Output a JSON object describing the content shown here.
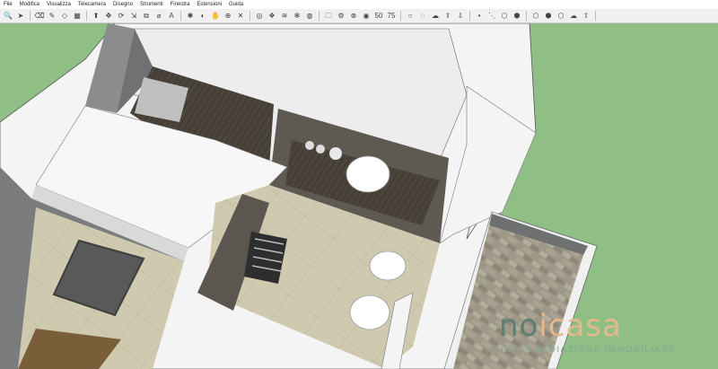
{
  "menu": {
    "items": [
      "File",
      "Modifica",
      "Visualizza",
      "Telecamera",
      "Disegno",
      "Strumenti",
      "Finestra",
      "Estensioni",
      "Guida"
    ]
  },
  "toolbar": {
    "tools": [
      {
        "name": "search-icon",
        "glyph": "🔍"
      },
      {
        "name": "select-arrow-icon",
        "glyph": "➤"
      },
      {
        "name": "eraser-icon",
        "glyph": "⌫"
      },
      {
        "name": "pencil-icon",
        "glyph": "✎"
      },
      {
        "name": "shape-icon",
        "glyph": "◇"
      },
      {
        "name": "paint-bucket-icon",
        "glyph": "▦"
      },
      {
        "name": "push-pull-icon",
        "glyph": "⬆"
      },
      {
        "name": "move-icon",
        "glyph": "✥"
      },
      {
        "name": "rotate-icon",
        "glyph": "⟳"
      },
      {
        "name": "scale-icon",
        "glyph": "⇲"
      },
      {
        "name": "offset-icon",
        "glyph": "⧉"
      },
      {
        "name": "tape-measure-icon",
        "glyph": "⌀"
      },
      {
        "name": "text-icon",
        "glyph": "A"
      },
      {
        "name": "axes-icon",
        "glyph": "✱"
      },
      {
        "name": "orbit-icon",
        "glyph": "◐"
      },
      {
        "name": "pan-icon",
        "glyph": "✋"
      },
      {
        "name": "zoom-icon",
        "glyph": "⊕"
      },
      {
        "name": "zoom-extents-icon",
        "glyph": "✕"
      },
      {
        "name": "warehouse-icon",
        "glyph": "◎"
      },
      {
        "name": "extension-icon",
        "glyph": "❖"
      },
      {
        "name": "layers-icon",
        "glyph": "≋"
      },
      {
        "name": "style-icon",
        "glyph": "✻"
      },
      {
        "name": "components-icon",
        "glyph": "◍"
      },
      {
        "name": "folder-icon",
        "glyph": "🗀"
      },
      {
        "name": "gear-icon",
        "glyph": "⚙"
      },
      {
        "name": "close-icon",
        "glyph": "⊗"
      },
      {
        "name": "profile-icon",
        "glyph": "◉"
      },
      {
        "name": "fifty-icon",
        "glyph": "50"
      },
      {
        "name": "seventy-five-icon",
        "glyph": "75"
      },
      {
        "name": "circle-outline-icon",
        "glyph": "○"
      },
      {
        "name": "ring-icon",
        "glyph": "◌"
      },
      {
        "name": "cloud-icon",
        "glyph": "☁"
      },
      {
        "name": "cloud-upload-icon",
        "glyph": "⇪"
      },
      {
        "name": "cloud-download-icon",
        "glyph": "⇩"
      },
      {
        "name": "dot-icon",
        "glyph": "•"
      },
      {
        "name": "line-icon",
        "glyph": "⋱"
      },
      {
        "name": "hexagon-icon",
        "glyph": "⬡"
      },
      {
        "name": "hexagon-gear-icon",
        "glyph": "⬢"
      },
      {
        "name": "hexagon-outline-icon",
        "glyph": "⬡"
      },
      {
        "name": "cube-icon",
        "glyph": "⬢"
      },
      {
        "name": "hexagon-dots-icon",
        "glyph": "⬡"
      },
      {
        "name": "cloud-sync-icon",
        "glyph": "☁"
      },
      {
        "name": "cloud-arrow-icon",
        "glyph": "⇧"
      }
    ]
  },
  "watermark": {
    "logo_part1": "no",
    "logo_part2": "icasa",
    "tagline": "INTERMEDIAZIONE IMMOBILIARE"
  },
  "colors": {
    "background": "#8fbf85",
    "wall": "#f7f7f7",
    "floor": "#cfc9b0",
    "wood": "#4a4338",
    "accent": "#5b7f72"
  }
}
